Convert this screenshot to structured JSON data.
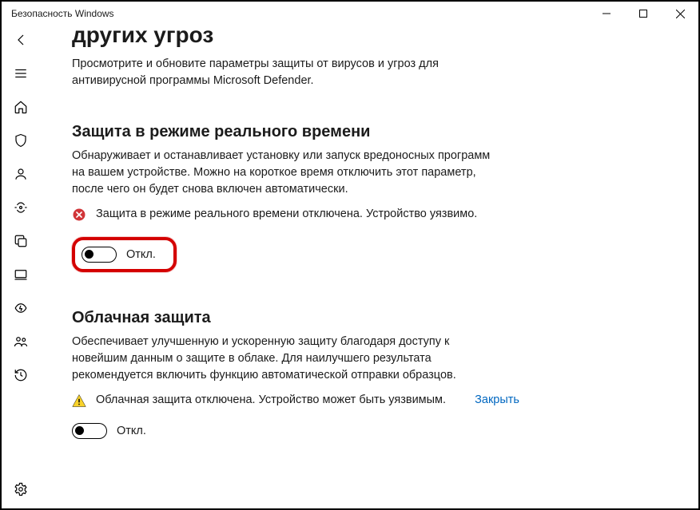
{
  "window": {
    "title": "Безопасность Windows"
  },
  "page": {
    "title": "других угроз",
    "description": "Просмотрите и обновите параметры защиты от вирусов и угроз для антивирусной программы Microsoft Defender."
  },
  "section_realtime": {
    "heading": "Защита в режиме реального времени",
    "description": "Обнаруживает и останавливает установку или запуск вредоносных программ на вашем устройстве. Можно на короткое время отключить этот параметр, после чего он будет снова включен автоматически.",
    "warning": "Защита в режиме реального времени отключена. Устройство уязвимо.",
    "toggle_label": "Откл."
  },
  "section_cloud": {
    "heading": "Облачная защита",
    "description": "Обеспечивает улучшенную и ускоренную защиту благодаря доступу к новейшим данным о защите в облаке. Для наилучшего результата рекомендуется включить функцию автоматической отправки образцов.",
    "warning": "Облачная защита отключена. Устройство может быть уязвимым.",
    "dismiss": "Закрыть",
    "toggle_label": "Откл."
  },
  "sidebar": {
    "items": [
      "back",
      "menu",
      "home",
      "shield",
      "account",
      "firewall",
      "appbrowser",
      "device",
      "performance",
      "family",
      "history"
    ],
    "footer": "settings"
  }
}
